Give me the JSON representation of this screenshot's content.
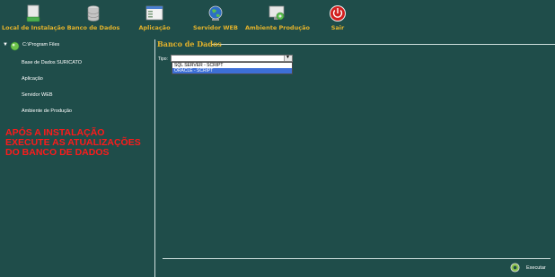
{
  "toolbar": {
    "items": [
      {
        "label": "Local de Instalação",
        "icon": "document-icon"
      },
      {
        "label": "Banco de Dados",
        "icon": "database-icon"
      },
      {
        "label": "Aplicação",
        "icon": "window-icon"
      },
      {
        "label": "Servidor WEB",
        "icon": "globe-icon"
      },
      {
        "label": "Ambiente Produção",
        "icon": "gear-monitor-icon"
      },
      {
        "label": "Sair",
        "icon": "power-icon"
      }
    ]
  },
  "sidebar": {
    "root_label": "C:\\Program Files",
    "items": [
      {
        "label": "Base de Dados SURICATO"
      },
      {
        "label": "Aplicação"
      },
      {
        "label": "Servidor WEB"
      },
      {
        "label": "Ambiente de Produção"
      }
    ],
    "warning_lines": [
      "APÓS A INSTALAÇÃO",
      "EXECUTE AS ATUALIZAÇÕES",
      "DO BANCO DE DADOS"
    ]
  },
  "panel": {
    "title": "Banco de Dados",
    "tipo_label": "Tipo:",
    "select_value": "",
    "options": [
      "SQL SERVER - SCRIPT",
      "ORACLE - SCRIPT"
    ],
    "selected_option_index": 1
  },
  "footer": {
    "execute_label": "Executar"
  },
  "colors": {
    "background": "#1f4d4a",
    "toolbar_label": "#e3b22b",
    "warning": "#ff1a1a",
    "selection": "#3d6fd6"
  }
}
